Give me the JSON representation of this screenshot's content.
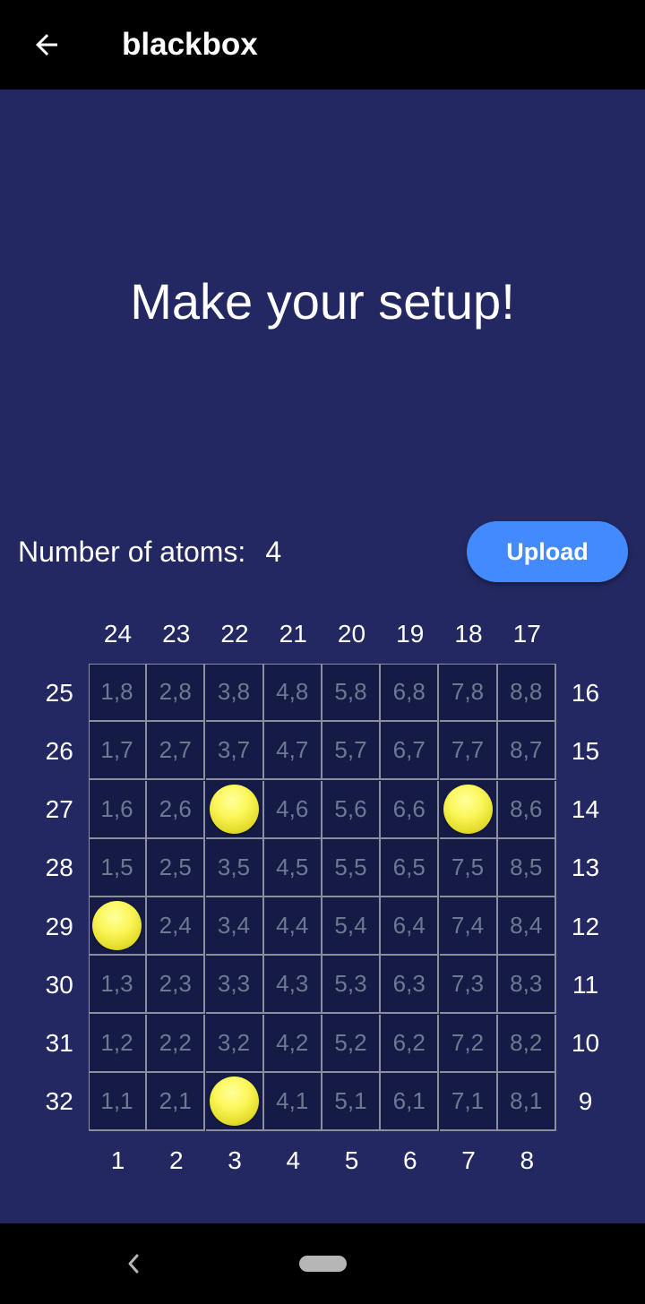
{
  "appbar": {
    "title": "blackbox",
    "back_icon": "arrow-left-icon"
  },
  "headline": "Make your setup!",
  "atoms": {
    "label": "Number of atoms:",
    "count": "4"
  },
  "upload_button": {
    "label": "Upload",
    "color": "#448aff"
  },
  "board": {
    "top_labels": [
      "24",
      "23",
      "22",
      "21",
      "20",
      "19",
      "18",
      "17"
    ],
    "bottom_labels": [
      "1",
      "2",
      "3",
      "4",
      "5",
      "6",
      "7",
      "8"
    ],
    "left_labels": [
      "25",
      "26",
      "27",
      "28",
      "29",
      "30",
      "31",
      "32"
    ],
    "right_labels": [
      "16",
      "15",
      "14",
      "13",
      "12",
      "11",
      "10",
      "9"
    ],
    "rows": [
      [
        "1,8",
        "2,8",
        "3,8",
        "4,8",
        "5,8",
        "6,8",
        "7,8",
        "8,8"
      ],
      [
        "1,7",
        "2,7",
        "3,7",
        "4,7",
        "5,7",
        "6,7",
        "7,7",
        "8,7"
      ],
      [
        "1,6",
        "2,6",
        "3,6",
        "4,6",
        "5,6",
        "6,6",
        "7,6",
        "8,6"
      ],
      [
        "1,5",
        "2,5",
        "3,5",
        "4,5",
        "5,5",
        "6,5",
        "7,5",
        "8,5"
      ],
      [
        "1,4",
        "2,4",
        "3,4",
        "4,4",
        "5,4",
        "6,4",
        "7,4",
        "8,4"
      ],
      [
        "1,3",
        "2,3",
        "3,3",
        "4,3",
        "5,3",
        "6,3",
        "7,3",
        "8,3"
      ],
      [
        "1,2",
        "2,2",
        "3,2",
        "4,2",
        "5,2",
        "6,2",
        "7,2",
        "8,2"
      ],
      [
        "1,1",
        "2,1",
        "3,1",
        "4,1",
        "5,1",
        "6,1",
        "7,1",
        "8,1"
      ]
    ],
    "atoms_at": [
      "3,6",
      "7,6",
      "1,4",
      "3,1"
    ],
    "atom_color": "#f5ef45"
  },
  "navbar": {
    "back_icon": "nav-back-chevron-icon",
    "home_icon": "home-pill-icon"
  },
  "colors": {
    "background": "#232862",
    "grid_cell": "#151b45",
    "grid_line": "#8a8e9e",
    "bar": "#000000"
  }
}
